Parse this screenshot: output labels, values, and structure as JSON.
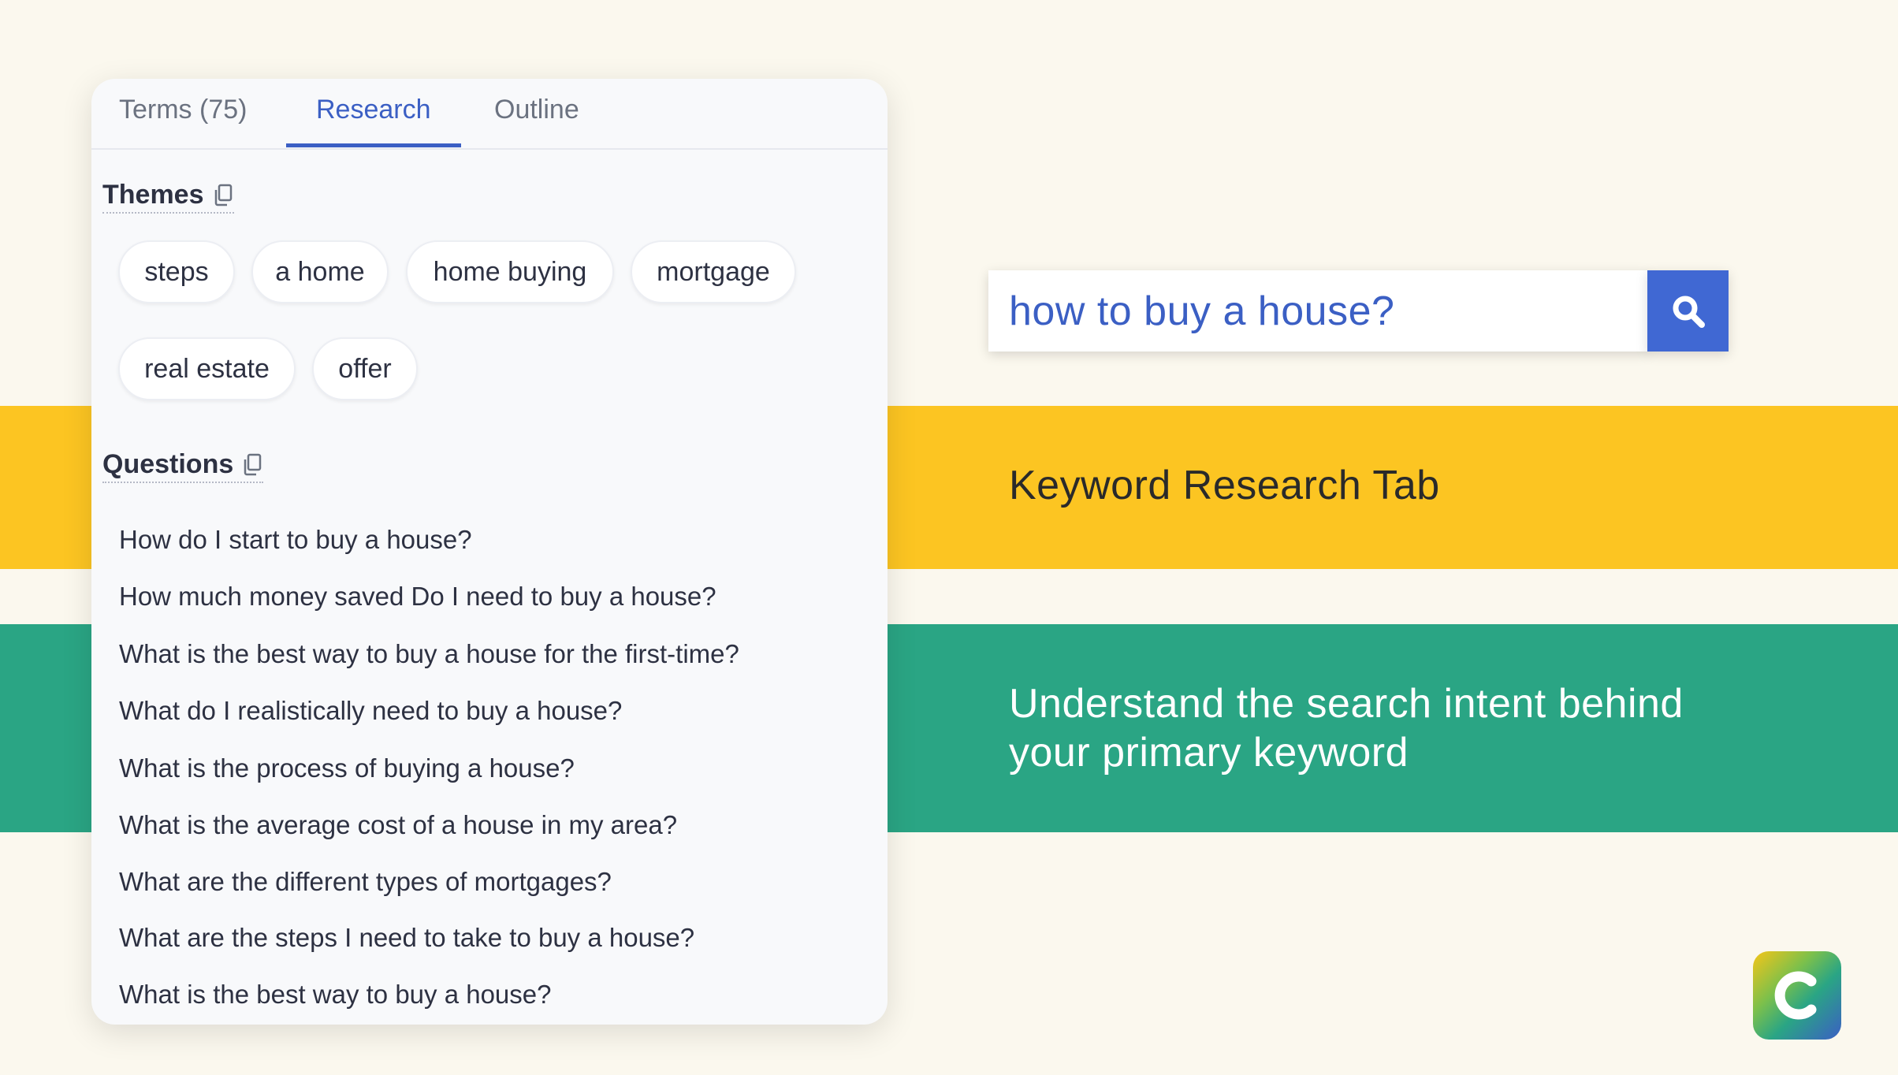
{
  "panel": {
    "tabs": [
      {
        "label": "Terms (75)"
      },
      {
        "label": "Research"
      },
      {
        "label": "Outline"
      }
    ],
    "active_tab": "Research",
    "themes": {
      "title": "Themes",
      "items": [
        "steps",
        "a home",
        "home buying",
        "mortgage",
        "real estate",
        "offer"
      ]
    },
    "questions": {
      "title": "Questions",
      "items": [
        "How do I start to buy a house?",
        "How much money saved Do I need to buy a house?",
        "What is the best way to buy a house for the first-time?",
        "What do I realistically need to buy a house?",
        "What is the process of buying a house?",
        "What is the average cost of a house in my area?",
        "What are the different types of mortgages?",
        "What are the steps I need to take to buy a house?",
        "What is the best way to buy a house?"
      ]
    }
  },
  "search": {
    "value": "how to buy a house?",
    "button_icon": "search-icon"
  },
  "banners": {
    "yellow_text": "Keyword Research Tab",
    "green_line1": "Understand the search intent behind",
    "green_line2": "your primary keyword"
  },
  "logo": {
    "letter": "C",
    "icon": "brand-logo-icon"
  },
  "colors": {
    "background": "#fbf8ee",
    "yellow_band": "#fcc522",
    "green_band": "#2aa584",
    "accent_blue": "#3b5fc4",
    "search_button": "#4068d3"
  }
}
